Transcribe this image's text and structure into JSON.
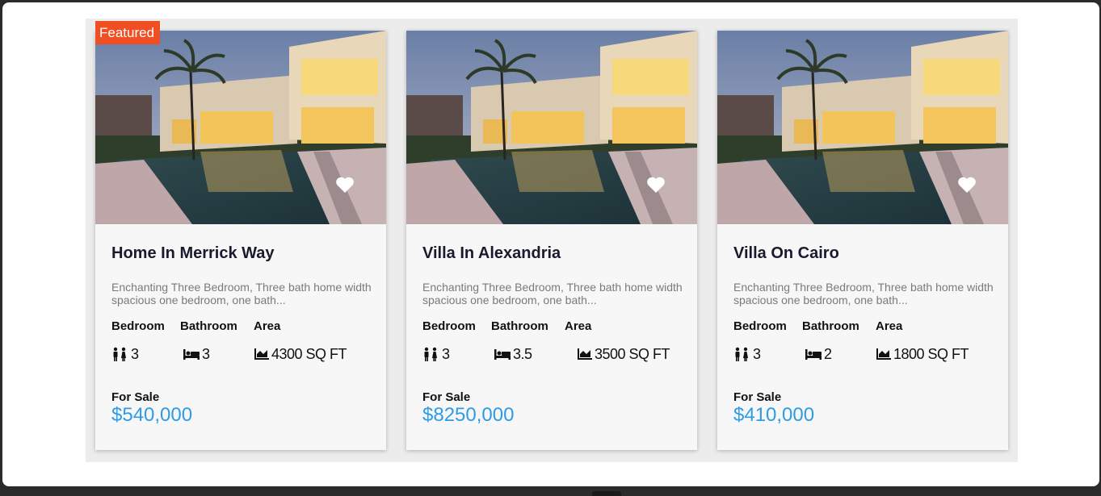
{
  "featured_label": "Featured",
  "colors": {
    "accent_price": "#2e9be6",
    "featured_tag": "#f04e23",
    "title": "#1a1a2e"
  },
  "cards": [
    {
      "title": "Home In Merrick Way",
      "description": "Enchanting Three Bedroom, Three bath home width spacious one bedroom, one bath...",
      "labels": {
        "bedroom": "Bedroom",
        "bathroom": "Bathroom",
        "area": "Area"
      },
      "bedrooms": "3",
      "bathrooms": "3",
      "area": "4300 SQ FT",
      "status": "For Sale",
      "price": "$540,000",
      "favorite_icon": "heart-icon"
    },
    {
      "title": "Villa In Alexandria",
      "description": "Enchanting Three Bedroom, Three bath home width spacious one bedroom, one bath...",
      "labels": {
        "bedroom": "Bedroom",
        "bathroom": "Bathroom",
        "area": "Area"
      },
      "bedrooms": "3",
      "bathrooms": "3.5",
      "area": "3500 SQ FT",
      "status": "For Sale",
      "price": "$8250,000",
      "favorite_icon": "heart-icon"
    },
    {
      "title": "Villa On Cairo",
      "description": "Enchanting Three Bedroom, Three bath home width spacious one bedroom, one bath...",
      "labels": {
        "bedroom": "Bedroom",
        "bathroom": "Bathroom",
        "area": "Area"
      },
      "bedrooms": "3",
      "bathrooms": "2",
      "area": "1800 SQ FT",
      "status": "For Sale",
      "price": "$410,000",
      "favorite_icon": "heart-icon"
    }
  ]
}
